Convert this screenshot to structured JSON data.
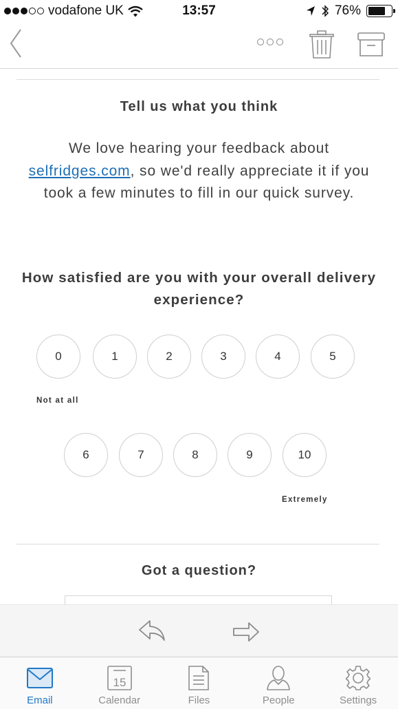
{
  "status_bar": {
    "carrier": "vodafone UK",
    "time": "13:57",
    "battery": "76%",
    "battery_level": 0.76
  },
  "email": {
    "heading": "Tell us what you think",
    "intro_before": "We love hearing your feedback about ",
    "intro_link": "selfridges.com",
    "intro_after": ", so we'd really appreciate it if you took a few minutes to fill in our quick survey.",
    "question": "How satisfied are you with your overall delivery experience?",
    "ratings_row1": [
      "0",
      "1",
      "2",
      "3",
      "4",
      "5"
    ],
    "ratings_row2": [
      "6",
      "7",
      "8",
      "9",
      "10"
    ],
    "low_label": "Not at all",
    "high_label": "Extremely",
    "question_heading": "Got a question?"
  },
  "tabs": [
    {
      "label": "Email",
      "icon": "mail-icon",
      "active": true
    },
    {
      "label": "Calendar",
      "icon": "calendar-icon",
      "day": "15"
    },
    {
      "label": "Files",
      "icon": "document-icon"
    },
    {
      "label": "People",
      "icon": "person-icon"
    },
    {
      "label": "Settings",
      "icon": "gear-icon"
    }
  ],
  "colors": {
    "accent": "#1f78c8",
    "link": "#1d6fb5",
    "text": "#404040"
  }
}
